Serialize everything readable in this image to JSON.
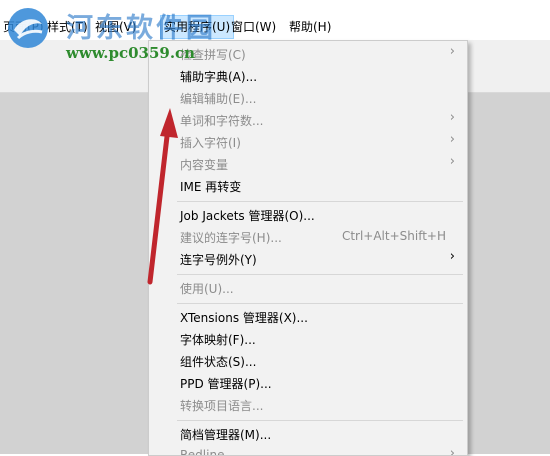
{
  "menubar": {
    "items": [
      {
        "label": "页面(P)"
      },
      {
        "label": "样式(T)"
      },
      {
        "label": "视图(V)"
      },
      {
        "label": "实用程序(U)"
      },
      {
        "label": "窗口(W)"
      },
      {
        "label": "帮助(H)"
      }
    ]
  },
  "menu": {
    "rows": [
      {
        "label": "检查拼写(C)",
        "shortcut": "",
        "submenu": true,
        "enabled": false
      },
      {
        "label": "辅助字典(A)...",
        "shortcut": "",
        "submenu": false,
        "enabled": true
      },
      {
        "label": "编辑辅助(E)...",
        "shortcut": "",
        "submenu": false,
        "enabled": false
      },
      {
        "label": "单词和字符数...",
        "shortcut": "",
        "submenu": true,
        "enabled": false
      },
      {
        "label": "插入字符(I)",
        "shortcut": "",
        "submenu": true,
        "enabled": false
      },
      {
        "label": "内容变量",
        "shortcut": "",
        "submenu": true,
        "enabled": false
      },
      {
        "label": "IME 再转变",
        "shortcut": "",
        "submenu": false,
        "enabled": true
      },
      {
        "label": "Job Jackets 管理器(O)...",
        "shortcut": "",
        "submenu": false,
        "enabled": true
      },
      {
        "label": "建议的连字号(H)...",
        "shortcut": "Ctrl+Alt+Shift+H",
        "submenu": false,
        "enabled": false
      },
      {
        "label": "连字号例外(Y)",
        "shortcut": "",
        "submenu": true,
        "enabled": true
      },
      {
        "label": "使用(U)...",
        "shortcut": "",
        "submenu": false,
        "enabled": false
      },
      {
        "label": "XTensions 管理器(X)...",
        "shortcut": "",
        "submenu": false,
        "enabled": true
      },
      {
        "label": "字体映射(F)...",
        "shortcut": "",
        "submenu": false,
        "enabled": true
      },
      {
        "label": "组件状态(S)...",
        "shortcut": "",
        "submenu": false,
        "enabled": true
      },
      {
        "label": "PPD 管理器(P)...",
        "shortcut": "",
        "submenu": false,
        "enabled": true
      },
      {
        "label": "转换项目语言...",
        "shortcut": "",
        "submenu": false,
        "enabled": false
      },
      {
        "label": "简档管理器(M)...",
        "shortcut": "",
        "submenu": false,
        "enabled": true
      },
      {
        "label": "Redline",
        "shortcut": "",
        "submenu": true,
        "enabled": false
      }
    ],
    "submenu_arrow": "›"
  },
  "watermark": {
    "title": "河东软件园",
    "url": "www.pc0359.cn"
  },
  "colors": {
    "menu_bg": "#f2f2f2",
    "workspace_bg": "#d2d2d2",
    "active_menu_bg": "#cce8ff",
    "annotation_arrow": "#c0262d"
  }
}
